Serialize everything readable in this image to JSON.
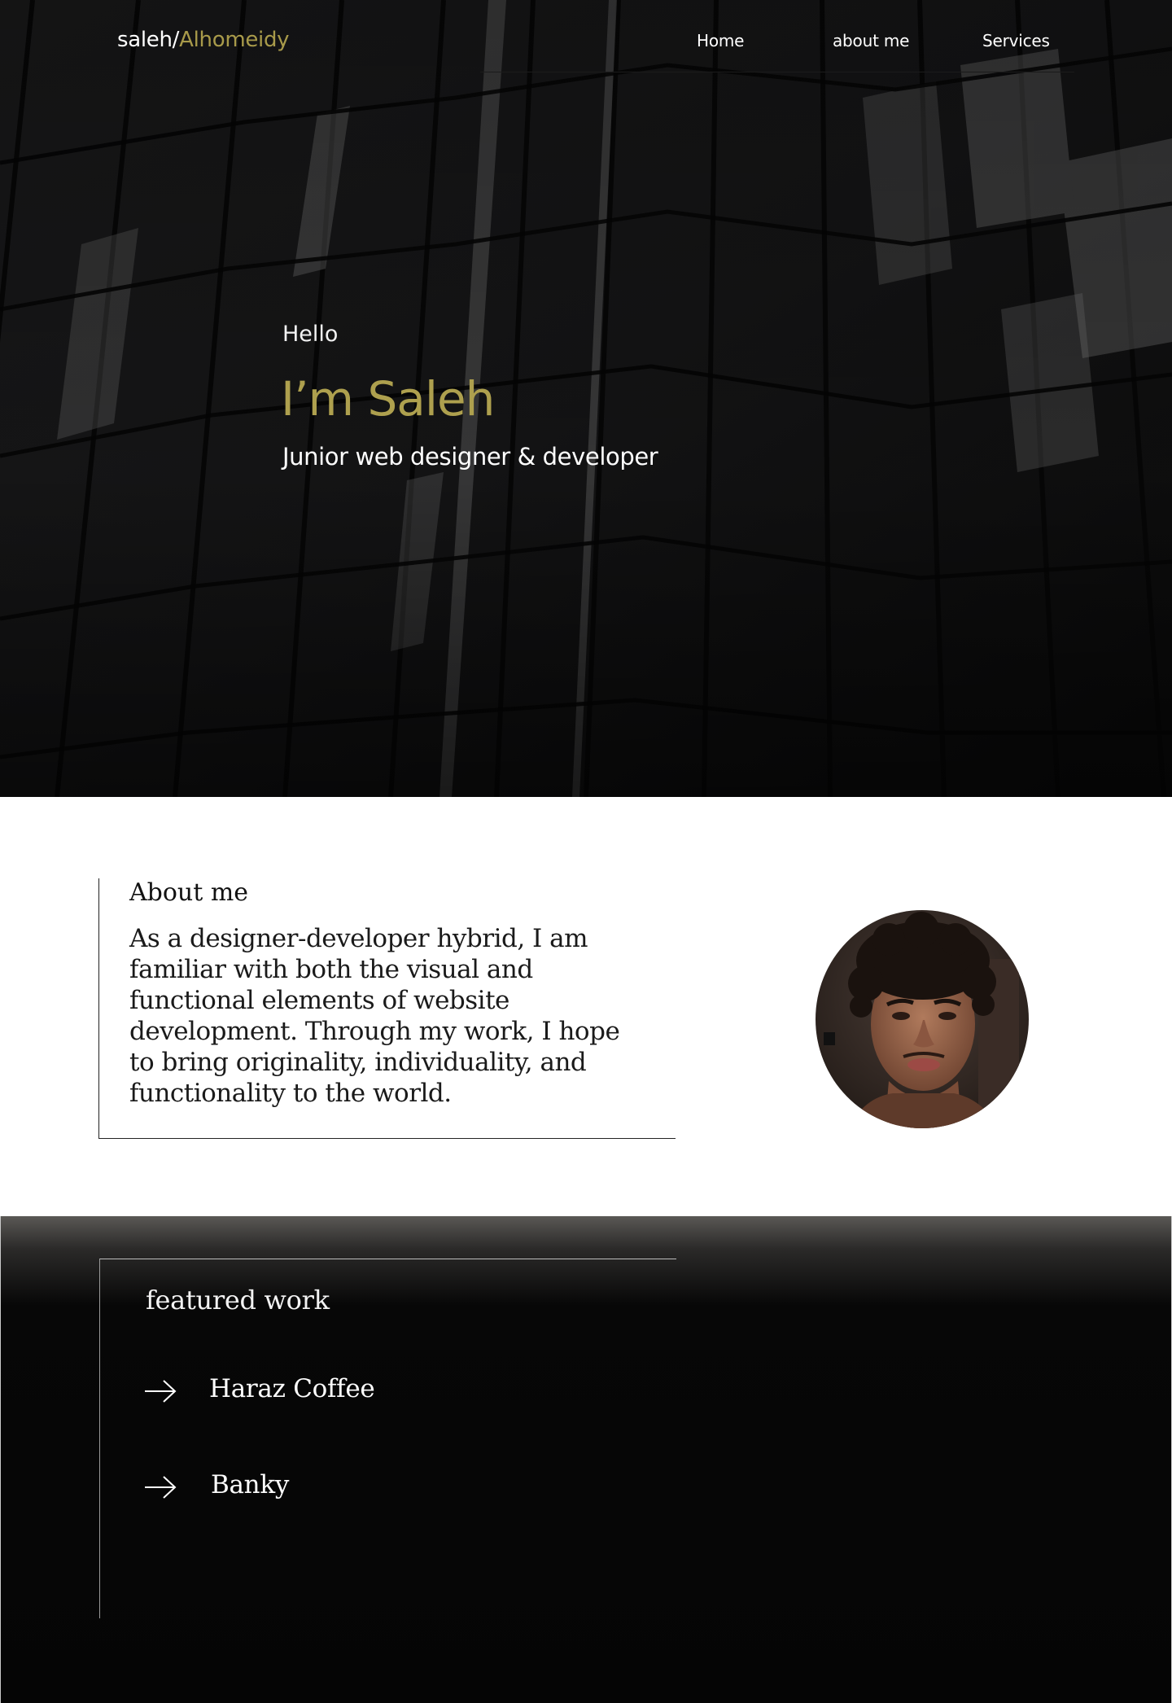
{
  "brand": {
    "name": "saleh/",
    "accent": "Alhomeidy",
    "accent_color": "#a89a4a"
  },
  "nav": {
    "items": [
      "Home",
      "about me",
      "Services"
    ]
  },
  "hero": {
    "greeting": "Hello",
    "name": "I’m Saleh",
    "role": "Junior web designer & developer",
    "name_color": "#aea04e",
    "background": "dark glass skyscraper facade photo"
  },
  "about": {
    "heading": "About me",
    "body": "As a designer-developer hybrid, I am familiar with both the visual and functional elements of website development. Through my work, I hope to bring originality, individuality, and functionality to the world.",
    "photo": "portrait photo of young man with curly hair"
  },
  "featured": {
    "heading": "featured work",
    "items": [
      {
        "label": "Haraz Coffee",
        "icon": "arrow-right-icon"
      },
      {
        "label": "Banky",
        "icon": "arrow-right-icon"
      }
    ]
  }
}
